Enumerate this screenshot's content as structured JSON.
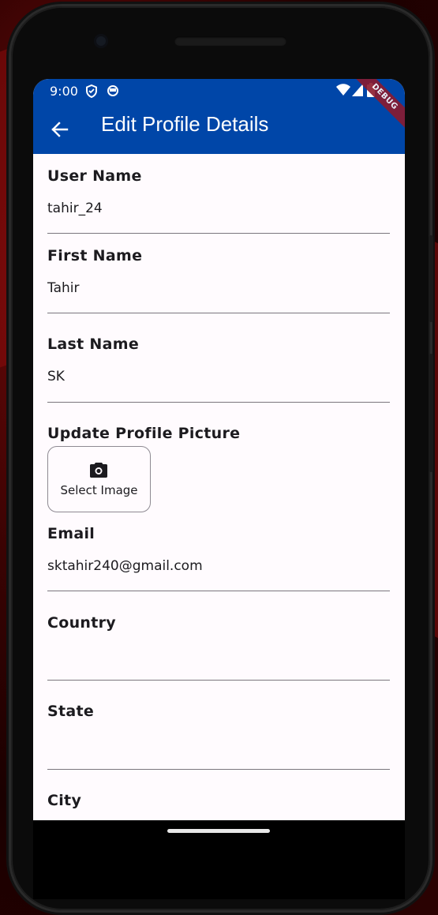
{
  "status_bar": {
    "time": "9:00",
    "icons": [
      "shield-icon",
      "data-saver-icon",
      "wifi-icon",
      "cellular-signal-icon",
      "battery-icon"
    ]
  },
  "app_bar": {
    "title": "Edit Profile Details",
    "back_icon": "arrow-back-icon",
    "background_color": "#0046a8"
  },
  "debug_banner": "DEBUG",
  "form": {
    "user_name": {
      "label": "User Name",
      "value": "tahir_24"
    },
    "first_name": {
      "label": "First Name",
      "value": "Tahir"
    },
    "last_name": {
      "label": "Last Name",
      "value": "SK"
    },
    "profile_picture": {
      "label": "Update Profile Picture",
      "button_label": "Select Image",
      "icon": "camera-icon"
    },
    "email": {
      "label": "Email",
      "value": "sktahir240@gmail.com"
    },
    "country": {
      "label": "Country",
      "value": ""
    },
    "state": {
      "label": "State",
      "value": ""
    },
    "city": {
      "label": "City",
      "value": ""
    }
  }
}
